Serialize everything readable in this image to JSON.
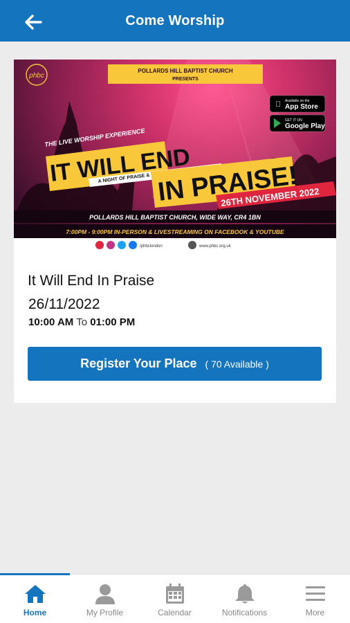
{
  "header": {
    "title": "Come Worship",
    "back_icon": "arrow-left-icon"
  },
  "banner": {
    "church_line1": "POLLARDS HILL BAPTIST CHURCH",
    "church_line2": "PRESENTS",
    "logo_text": "phbc",
    "kicker": "THE LIVE WORSHIP EXPERIENCE",
    "headline1": "IT WILL END",
    "subtitle": "A NIGHT OF PRAISE & THANKSGIVING",
    "headline2": "IN PRAISE!",
    "date_ribbon": "26TH NOVEMBER 2022",
    "venue": "POLLARDS HILL BAPTIST CHURCH, WIDE WAY, CR4 1BN",
    "times": "7:00PM - 9:00PM IN-PERSON & LIVESTREAMING ON FACEBOOK & YOUTUBE",
    "social_handle": "/phbclondon",
    "website": "www.phbc.org.uk",
    "appstore_top": "Available on the",
    "appstore": "App Store",
    "googleplay_top": "GET IT ON",
    "googleplay": "Google Play"
  },
  "event": {
    "title": "It Will End In Praise",
    "date": "26/11/2022",
    "start": "10:00 AM",
    "to": "To",
    "end": "01:00 PM"
  },
  "register": {
    "label": "Register Your Place",
    "availability": "( 70 Available )"
  },
  "nav": {
    "items": [
      {
        "label": "Home",
        "icon": "home-icon",
        "active": true
      },
      {
        "label": "My Profile",
        "icon": "person-icon",
        "active": false
      },
      {
        "label": "Calendar",
        "icon": "calendar-icon",
        "active": false
      },
      {
        "label": "Notifications",
        "icon": "bell-icon",
        "active": false
      },
      {
        "label": "More",
        "icon": "menu-icon",
        "active": false
      }
    ]
  },
  "colors": {
    "primary": "#1574be",
    "banner_yellow": "#f9c83a",
    "banner_red": "#e0263f"
  }
}
